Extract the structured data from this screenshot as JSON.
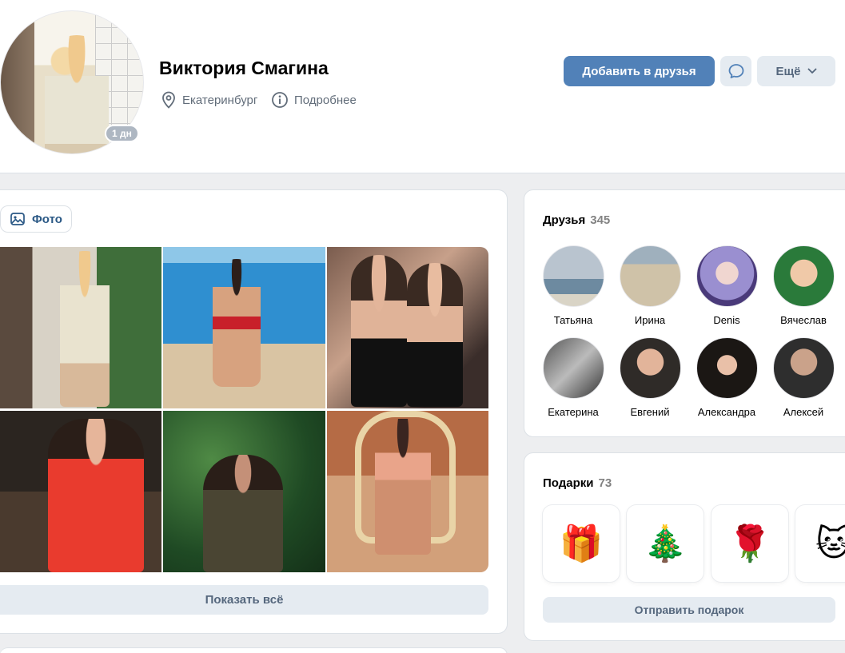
{
  "profile": {
    "name": "Виктория Смагина",
    "online_badge": "1 дн",
    "city": "Екатеринбург",
    "details_link": "Подробнее",
    "add_friend": "Добавить в друзья",
    "more": "Ещё"
  },
  "photos": {
    "tab_label": "Фото",
    "show_all": "Показать всё"
  },
  "friends": {
    "title": "Друзья",
    "count": "345",
    "items": [
      {
        "name": "Татьяна"
      },
      {
        "name": "Ирина"
      },
      {
        "name": "Denis"
      },
      {
        "name": "Вячеслав"
      },
      {
        "name": "Екатерина"
      },
      {
        "name": "Евгений"
      },
      {
        "name": "Александра"
      },
      {
        "name": "Алексей"
      }
    ]
  },
  "gifts": {
    "title": "Подарки",
    "count": "73",
    "send": "Отправить подарок",
    "items": [
      {
        "icon": "🎁"
      },
      {
        "icon": "🎄"
      },
      {
        "icon": "🌹"
      },
      {
        "icon": "🐱"
      }
    ]
  },
  "colors": {
    "primary": "#5181b8",
    "secondary_bg": "#e5ebf1",
    "link": "#2a5885",
    "page_bg": "#edeef0"
  }
}
